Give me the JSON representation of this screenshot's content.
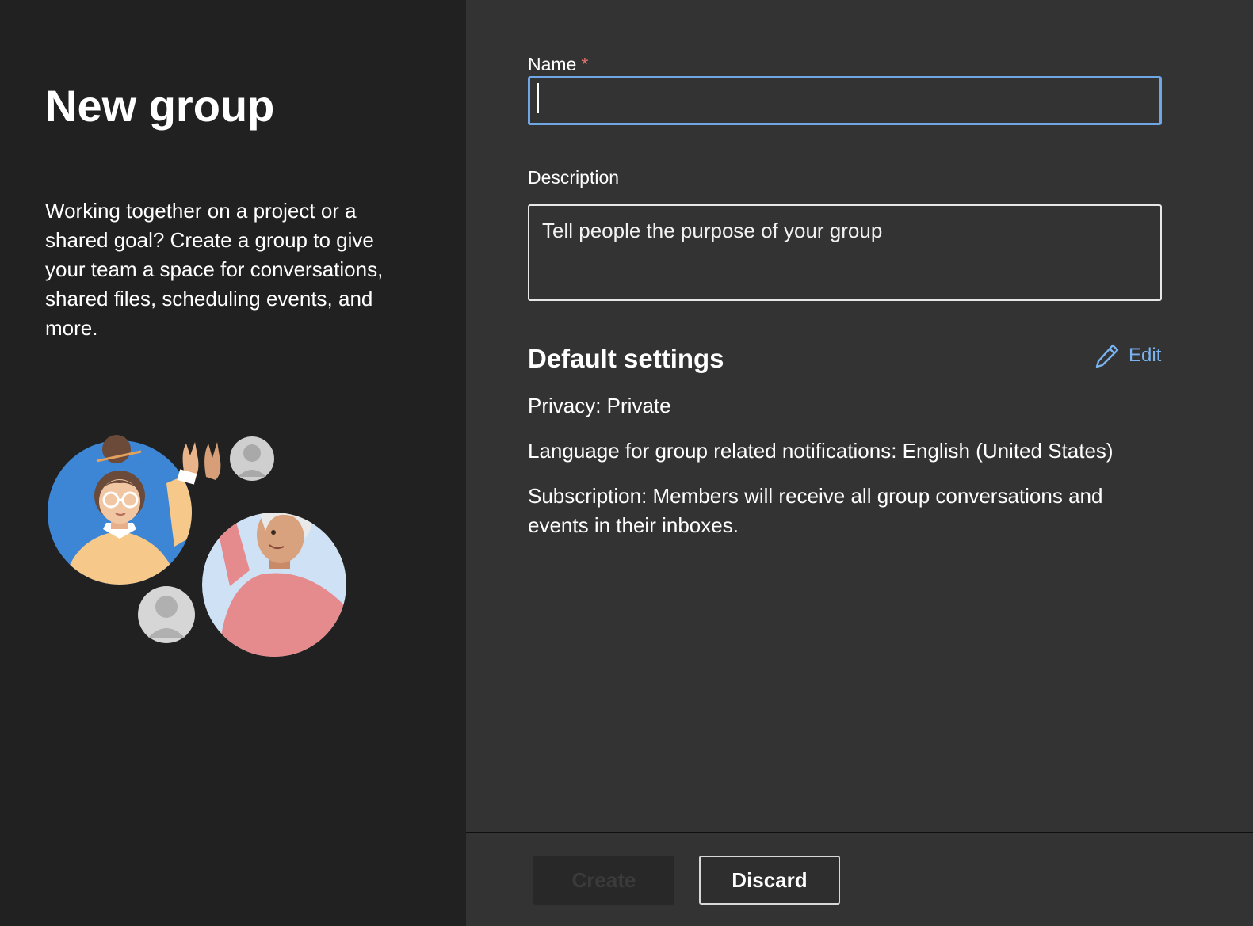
{
  "intro": {
    "title": "New group",
    "description": "Working together on a project or a shared goal? Create a group to give your team a space for conversations, shared files, scheduling events, and more."
  },
  "form": {
    "name_label": "Name",
    "required_marker": "*",
    "name_value": "",
    "description_label": "Description",
    "description_placeholder": "Tell people the purpose of your group"
  },
  "default_settings": {
    "title": "Default settings",
    "edit_label": "Edit",
    "edit_icon": "pencil-icon",
    "privacy": "Privacy: Private",
    "language": "Language for group related notifications: English (United States)",
    "subscription": "Subscription: Members will receive all group conversations and events in their inboxes."
  },
  "actions": {
    "create_label": "Create",
    "create_disabled": true,
    "discard_label": "Discard"
  },
  "colors": {
    "left_background": "#212121",
    "right_background": "#333333",
    "focus_border": "#6fa7e6",
    "link": "#7ab3f0",
    "required": "#e0716a"
  }
}
